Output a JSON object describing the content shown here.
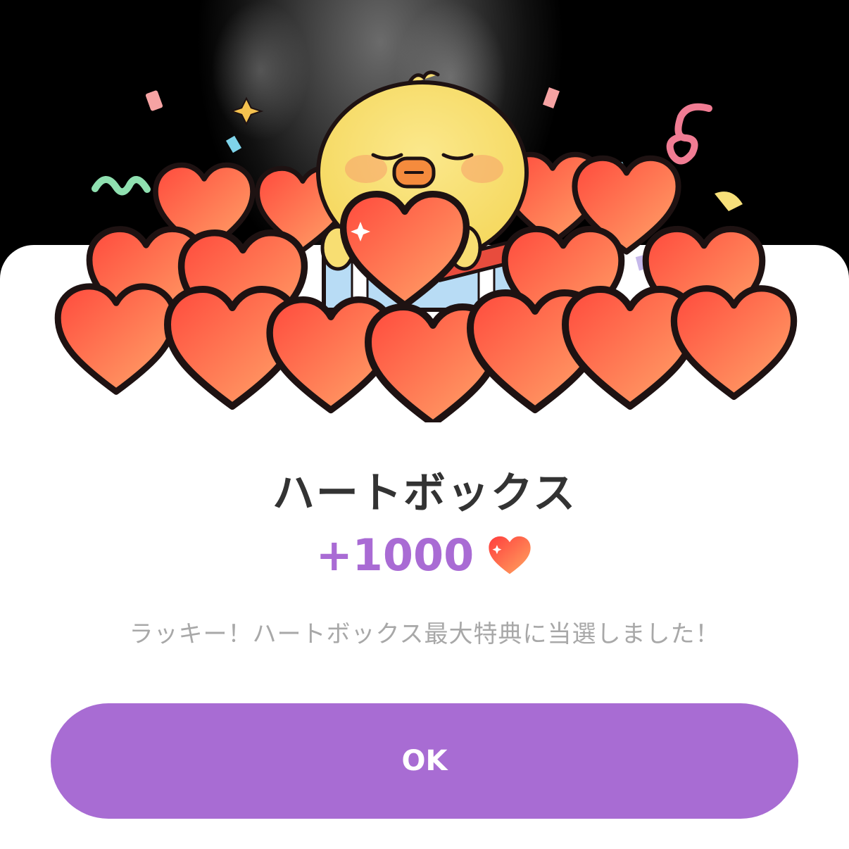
{
  "dialog": {
    "title": "ハートボックス",
    "reward_amount": "+1000",
    "reward_icon": "heart-icon",
    "message": "ラッキー！ハートボックス最大特典に当選しました！",
    "ok_label": "OK"
  },
  "illustration": {
    "subject": "chick-holding-heart-with-heart-pile",
    "accent_heart_color": "#ff5a4a",
    "chick_color": "#f8de72"
  },
  "colors": {
    "accent": "#a86cd3",
    "reward_text": "#a96bd4",
    "title_text": "#333333",
    "message_text": "#a8a8a8"
  }
}
